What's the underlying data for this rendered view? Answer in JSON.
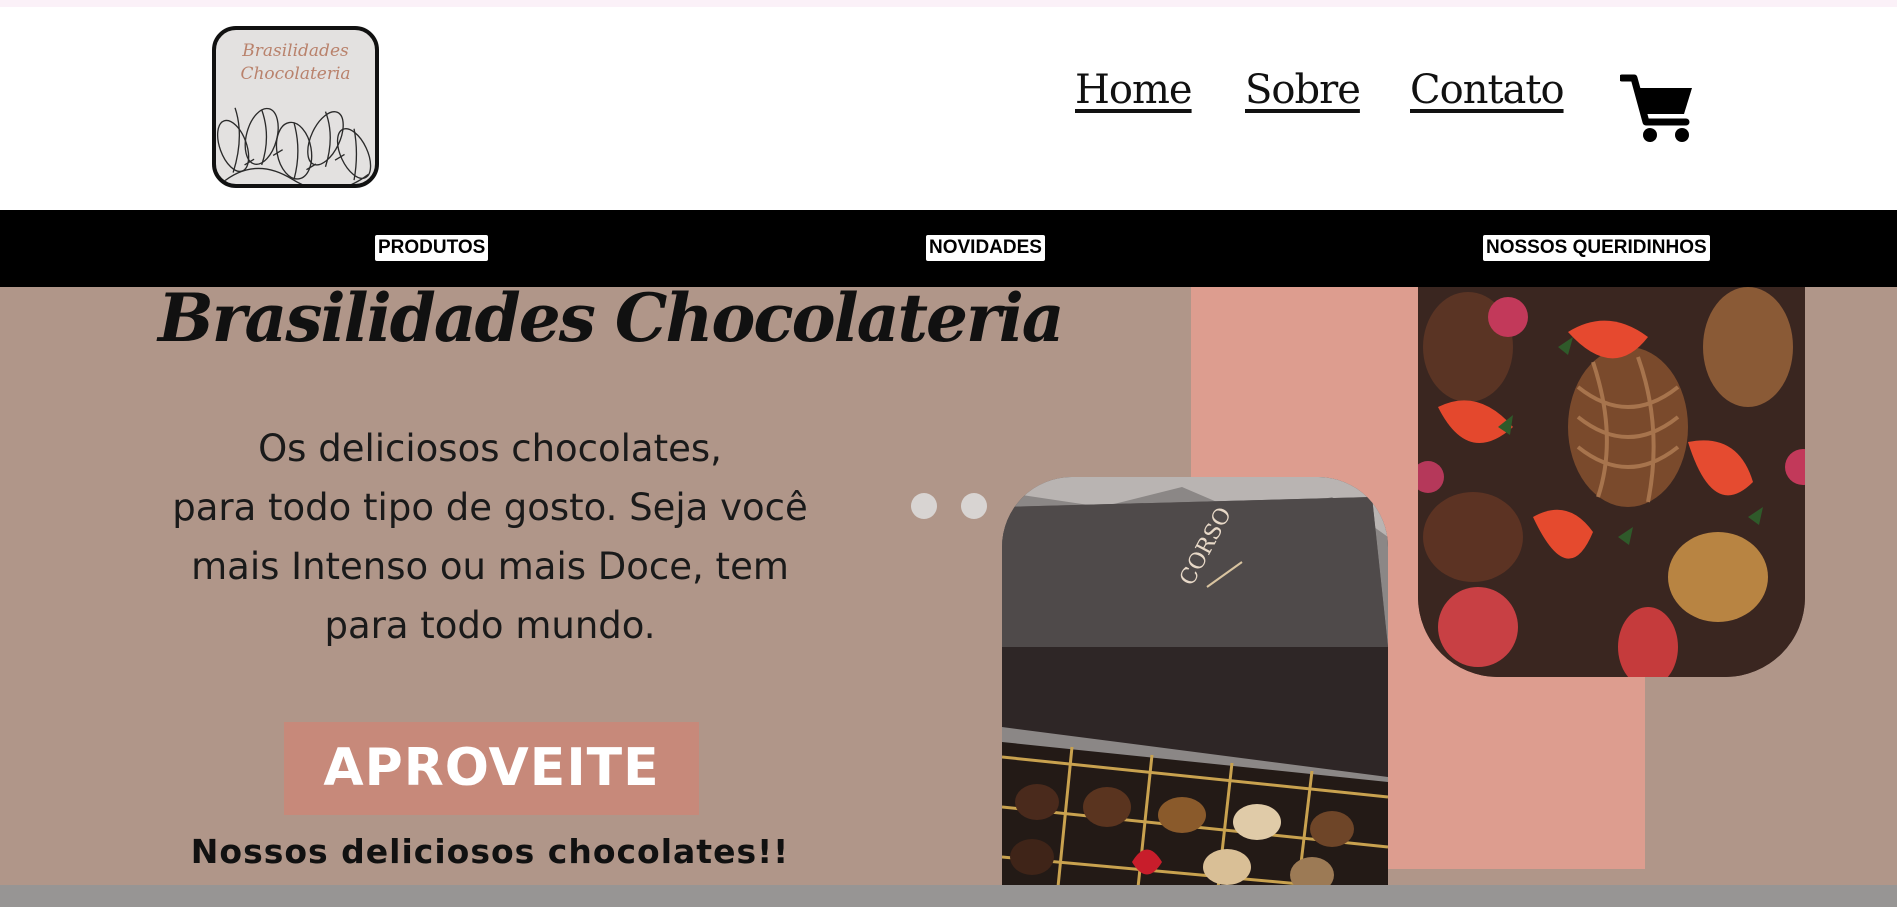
{
  "header": {
    "logo": {
      "line1": "Brasilidades",
      "line2": "Chocolateria"
    },
    "nav": [
      {
        "label": "Home"
      },
      {
        "label": "Sobre"
      },
      {
        "label": "Contato"
      }
    ],
    "cart_icon": "shopping-cart-icon"
  },
  "categories": [
    {
      "label": "PRODUTOS"
    },
    {
      "label": "NOVIDADES"
    },
    {
      "label": "NOSSOS QUERIDINHOS"
    }
  ],
  "hero": {
    "title": "Brasilidades Chocolateria",
    "description_lines": [
      "Os deliciosos chocolates,",
      "para todo tipo de gosto. Seja você",
      "mais Intenso ou mais Doce, tem",
      "para todo mundo."
    ],
    "cta": "APROVEITE",
    "tagline": "Nossos deliciosos chocolates!!"
  },
  "colors": {
    "hero_bg": "#b09689",
    "pink_panel": "#dd9d8f",
    "cta_bg": "#c7897a",
    "category_bar": "#000000"
  }
}
